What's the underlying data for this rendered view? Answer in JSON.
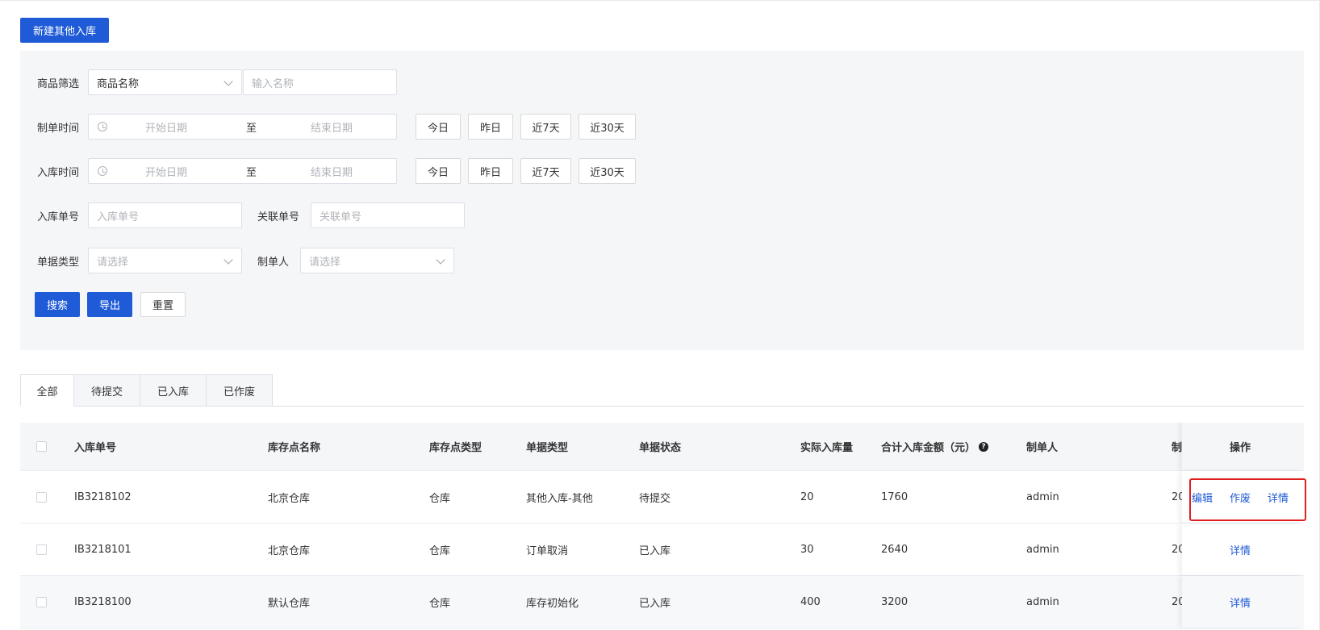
{
  "toolbar": {
    "new_button": "新建其他入库"
  },
  "filters": {
    "product": {
      "label": "商品筛选",
      "select_value": "商品名称",
      "input_placeholder": "输入名称"
    },
    "order_time": {
      "label": "制单时间",
      "start_placeholder": "开始日期",
      "separator": "至",
      "end_placeholder": "结束日期"
    },
    "inbound_time": {
      "label": "入库时间",
      "start_placeholder": "开始日期",
      "separator": "至",
      "end_placeholder": "结束日期"
    },
    "quick_ranges": [
      "今日",
      "昨日",
      "近7天",
      "近30天"
    ],
    "inbound_no": {
      "label": "入库单号",
      "placeholder": "入库单号"
    },
    "related_no": {
      "label": "关联单号",
      "placeholder": "关联单号"
    },
    "doc_type": {
      "label": "单据类型",
      "placeholder": "请选择"
    },
    "creator": {
      "label": "制单人",
      "placeholder": "请选择"
    },
    "actions": {
      "search": "搜索",
      "export": "导出",
      "reset": "重置"
    }
  },
  "tabs": [
    "全部",
    "待提交",
    "已入库",
    "已作废"
  ],
  "table": {
    "headers": {
      "inbound_no": "入库单号",
      "store_name": "库存点名称",
      "store_type": "库存点类型",
      "doc_type": "单据类型",
      "doc_status": "单据状态",
      "actual_qty": "实际入库量",
      "total_amount": "合计入库金额（元）",
      "creator": "制单人",
      "created_at_partial": "制",
      "operations": "操作"
    },
    "rows": [
      {
        "inbound_no": "IB3218102",
        "store_name": "北京仓库",
        "store_type": "仓库",
        "doc_type": "其他入库-其他",
        "doc_status": "待提交",
        "actual_qty": "20",
        "total_amount": "1760",
        "creator": "admin",
        "created_at_partial": "20",
        "ops": [
          "编辑",
          "作废",
          "详情"
        ]
      },
      {
        "inbound_no": "IB3218101",
        "store_name": "北京仓库",
        "store_type": "仓库",
        "doc_type": "订单取消",
        "doc_status": "已入库",
        "actual_qty": "30",
        "total_amount": "2640",
        "creator": "admin",
        "created_at_partial": "20",
        "ops": [
          "详情"
        ]
      },
      {
        "inbound_no": "IB3218100",
        "store_name": "默认仓库",
        "store_type": "仓库",
        "doc_type": "库存初始化",
        "doc_status": "已入库",
        "actual_qty": "400",
        "total_amount": "3200",
        "creator": "admin",
        "created_at_partial": "20",
        "ops": [
          "详情"
        ]
      }
    ]
  },
  "colors": {
    "primary": "#1f5bd6",
    "highlight": "#e02020",
    "panel_bg": "#f5f6f8"
  },
  "icons": [
    "clock-icon",
    "chevron-down-icon",
    "help-icon",
    "checkbox"
  ]
}
